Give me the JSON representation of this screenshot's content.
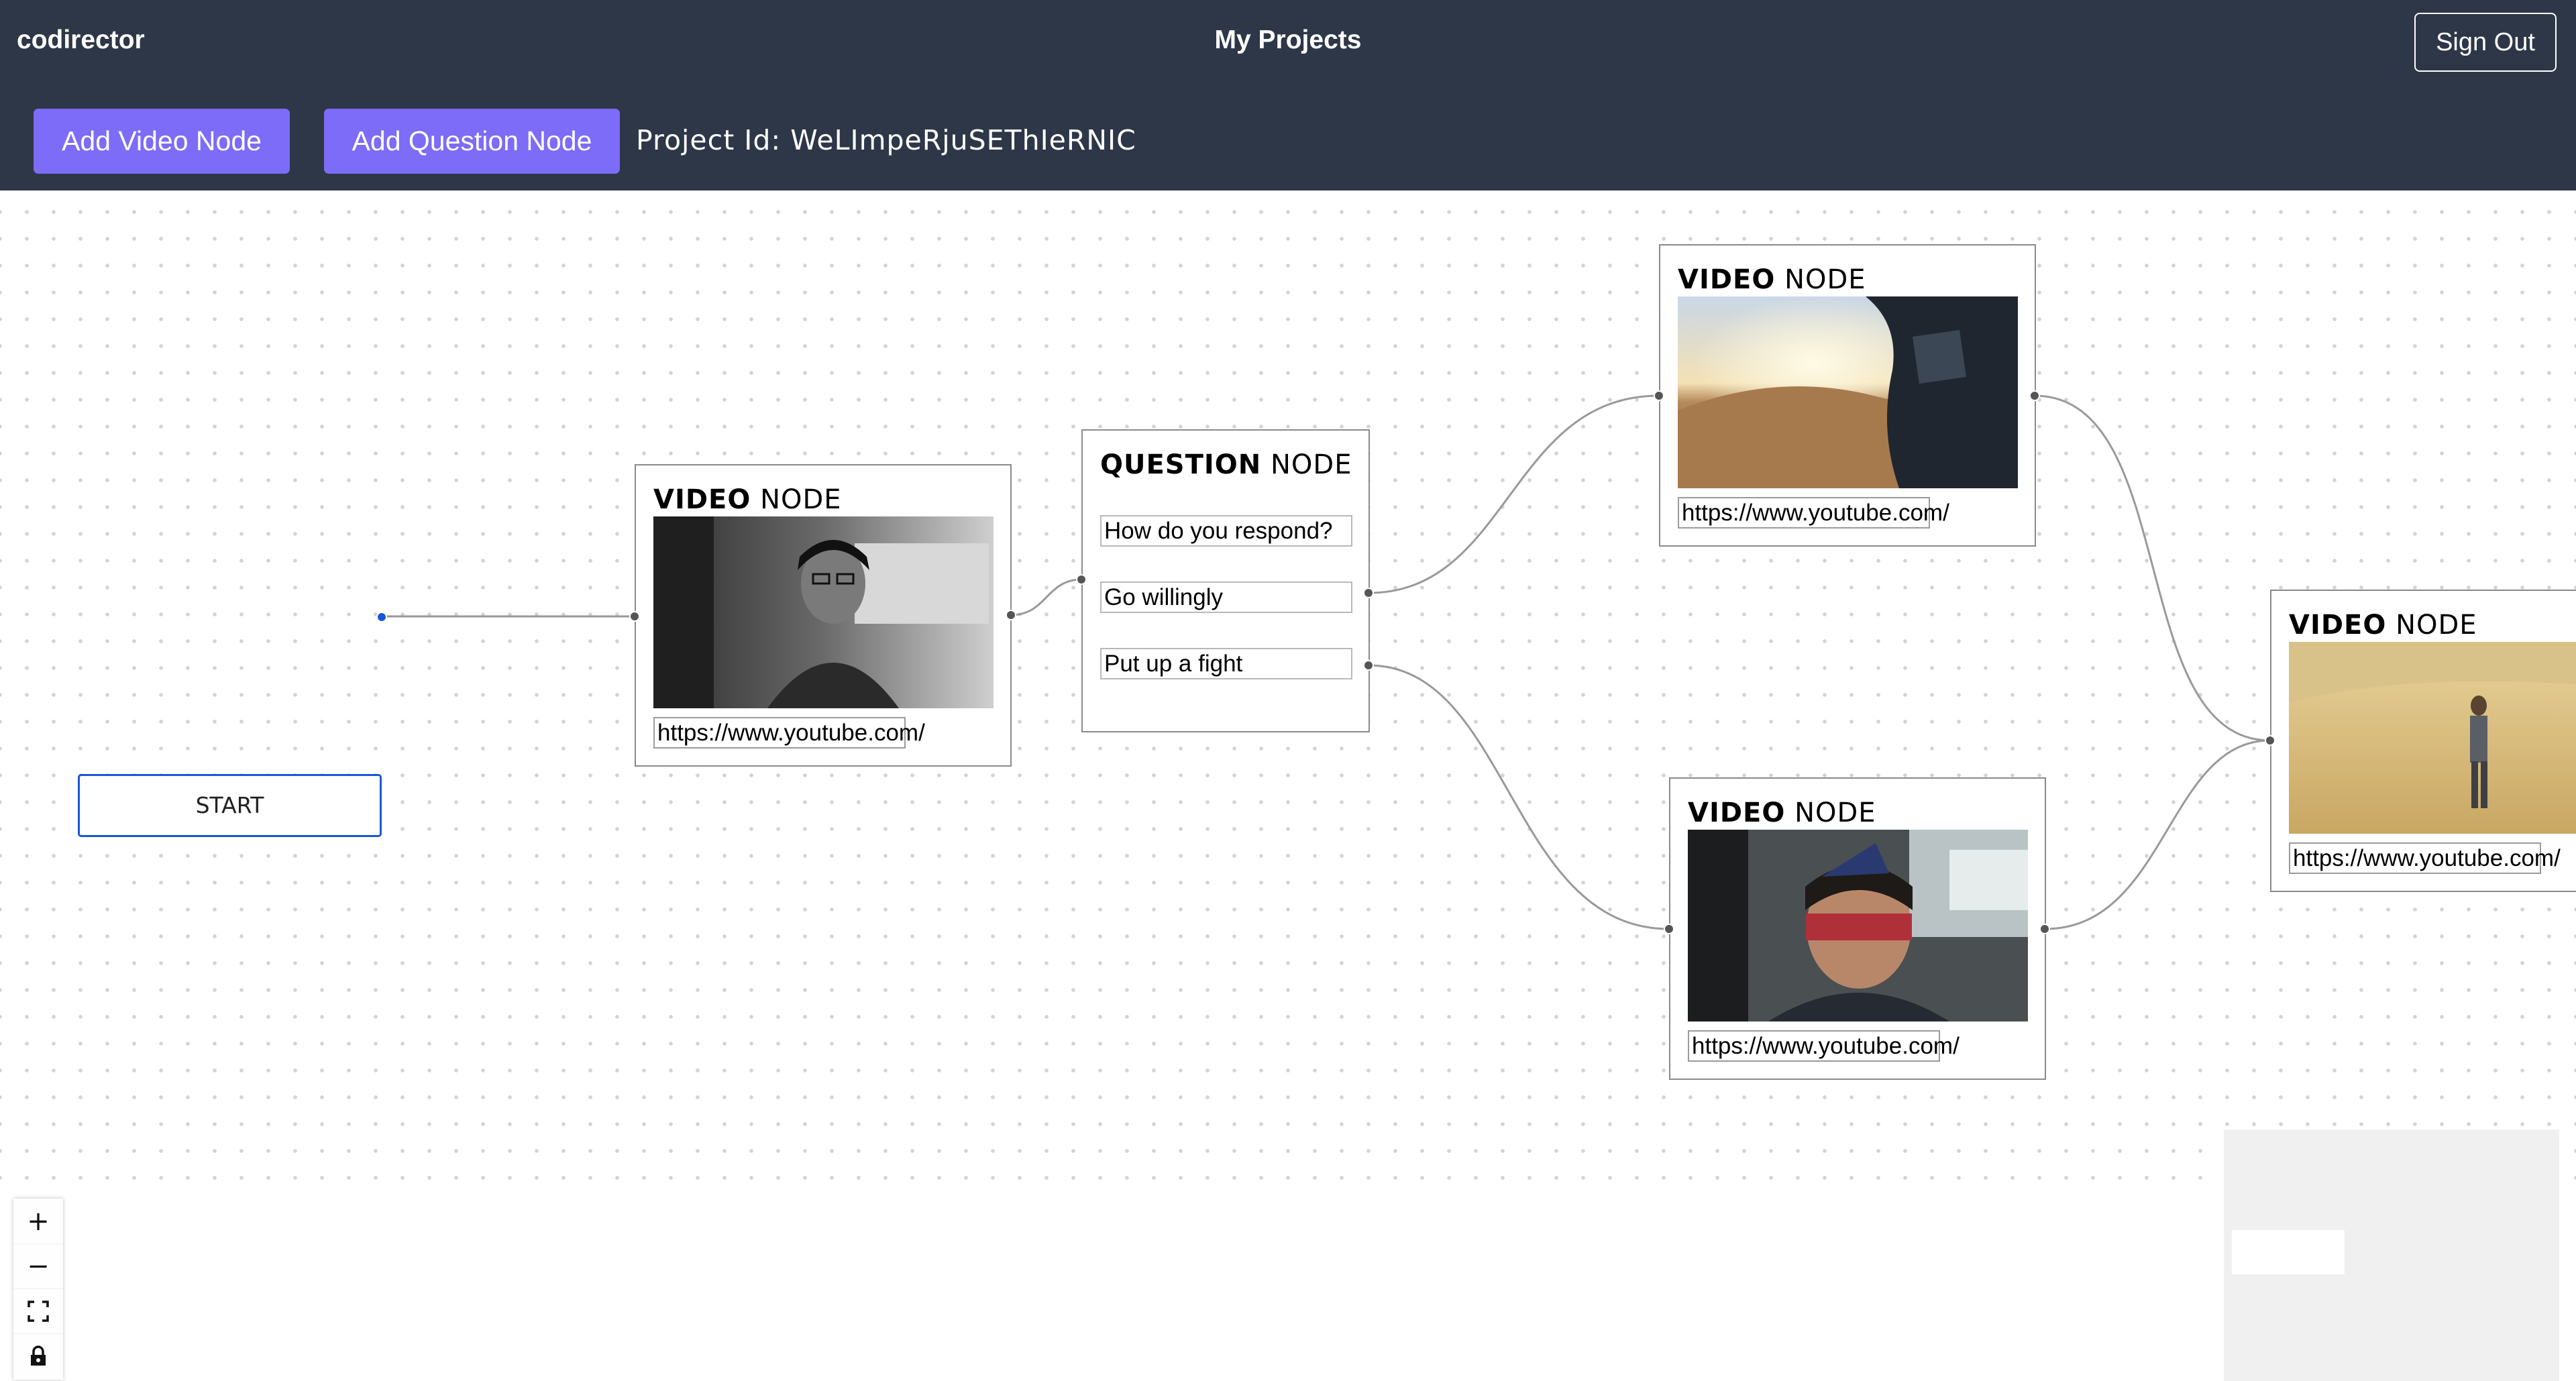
{
  "header": {
    "brand": "codirector",
    "title": "My Projects",
    "sign_out": "Sign Out"
  },
  "toolbar": {
    "add_video": "Add Video Node",
    "add_question": "Add Question Node",
    "project_id": "Project Id: WeLImpeRjuSEThIeRNIC"
  },
  "flow": {
    "start_label": "START",
    "video_title_bold": "VIDEO",
    "question_title_bold": "QUESTION",
    "node_suffix": "NODE",
    "video_url": "https://www.youtube.com/",
    "question": {
      "prompt": "How do you respond?",
      "option1": "Go willingly",
      "option2": "Put up a fight"
    }
  },
  "controls": {
    "zoom_in": "+",
    "zoom_out": "−"
  }
}
